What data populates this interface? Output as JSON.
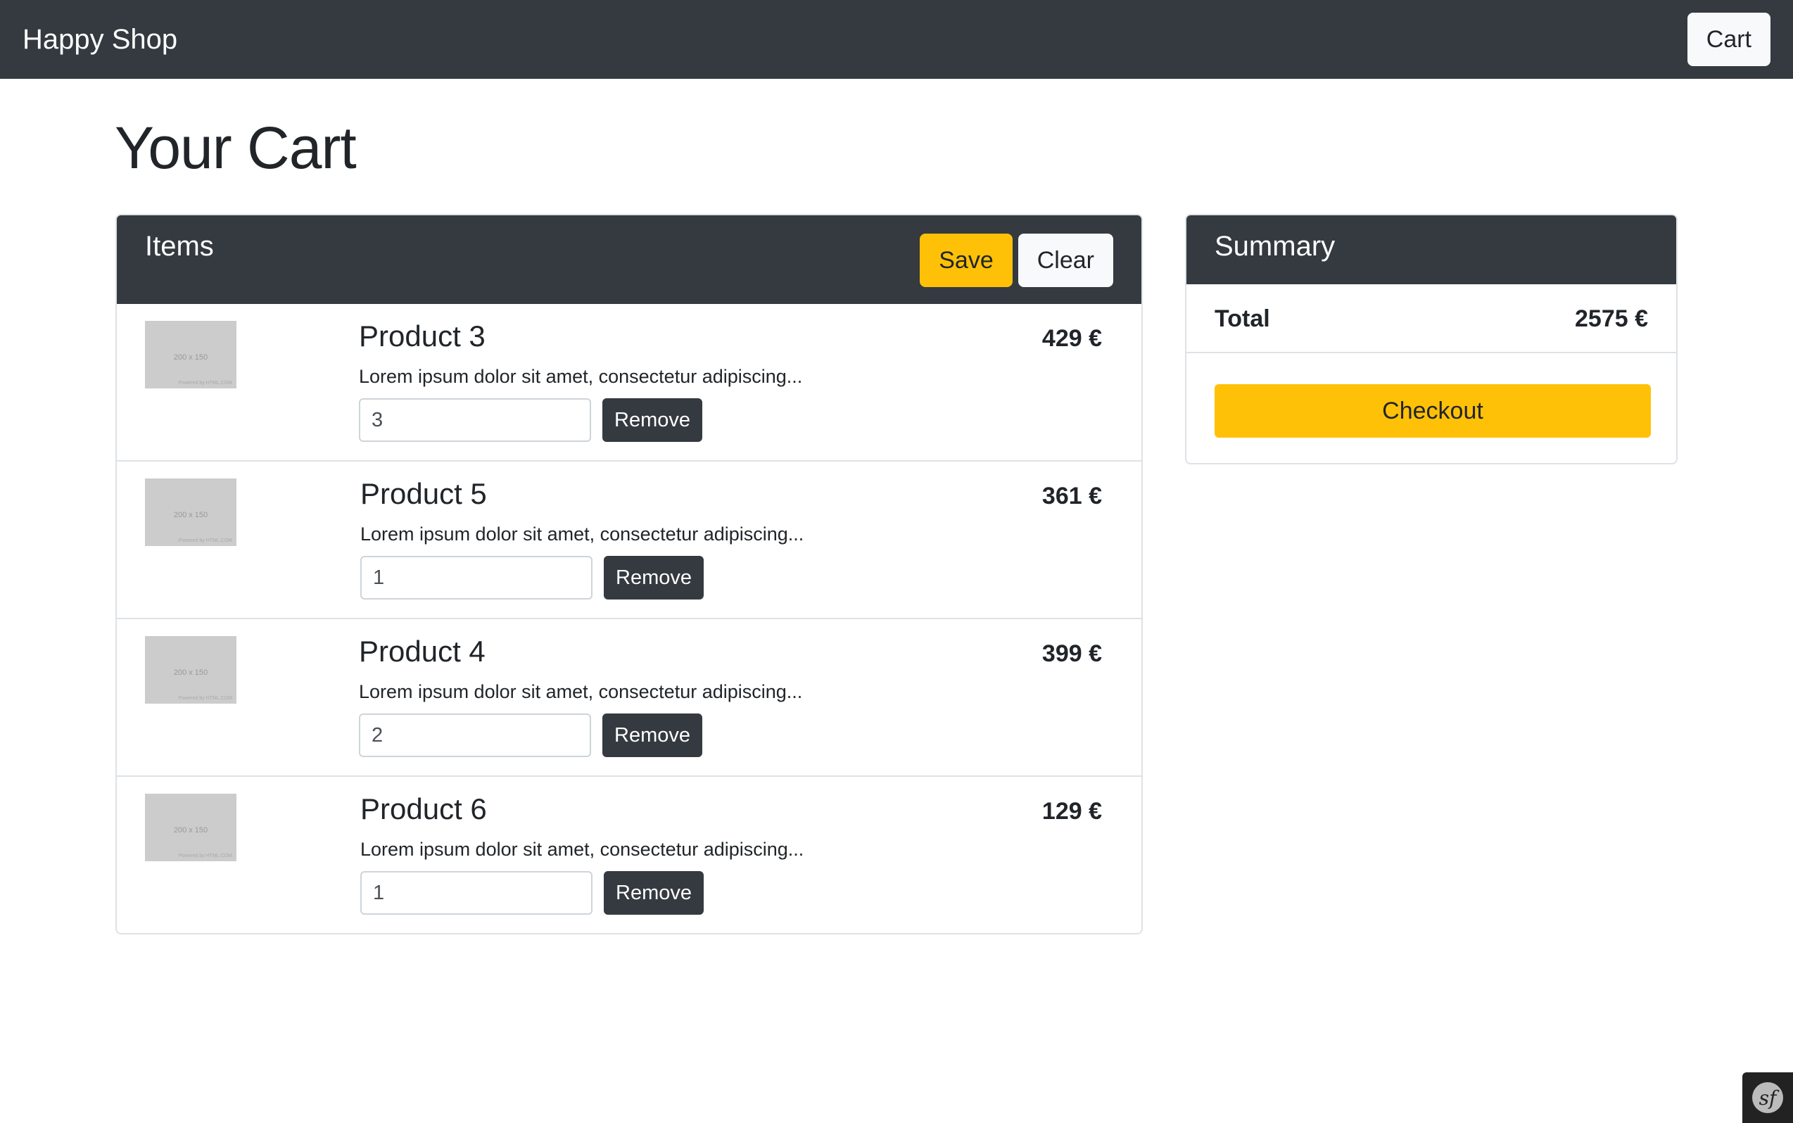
{
  "nav": {
    "brand": "Happy Shop",
    "cart_label": "Cart"
  },
  "page_title": "Your Cart",
  "items_card": {
    "title": "Items",
    "save_label": "Save",
    "clear_label": "Clear",
    "thumb_text": "200 x 150",
    "thumb_powered": "Powered by HTML.COM",
    "remove_label": "Remove",
    "items": [
      {
        "name": "Product 3",
        "description": "Lorem ipsum dolor sit amet, consectetur adipiscing...",
        "price": "429 €",
        "quantity": "3"
      },
      {
        "name": "Product 5",
        "description": "Lorem ipsum dolor sit amet, consectetur adipiscing...",
        "price": "361 €",
        "quantity": "1"
      },
      {
        "name": "Product 4",
        "description": "Lorem ipsum dolor sit amet, consectetur adipiscing...",
        "price": "399 €",
        "quantity": "2"
      },
      {
        "name": "Product 6",
        "description": "Lorem ipsum dolor sit amet, consectetur adipiscing...",
        "price": "129 €",
        "quantity": "1"
      }
    ]
  },
  "summary_card": {
    "title": "Summary",
    "total_label": "Total",
    "total_value": "2575 €",
    "checkout_label": "Checkout"
  },
  "icons": {
    "debug_toolbar": "symfony-logo-icon"
  },
  "colors": {
    "navbar": "#343a40",
    "warning": "#ffc107",
    "light": "#f8f9fa",
    "dark_button": "#343a40"
  }
}
